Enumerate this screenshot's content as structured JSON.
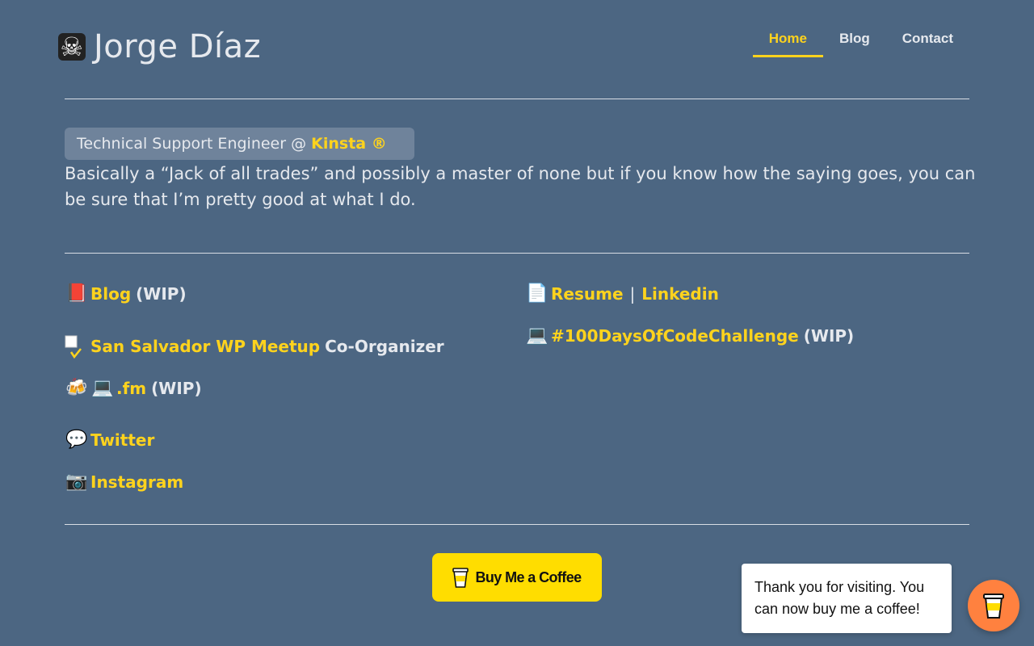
{
  "header": {
    "logo_emoji": "☠",
    "site_name": "Jorge Díaz",
    "nav": [
      {
        "label": "Home",
        "active": true
      },
      {
        "label": "Blog",
        "active": false
      },
      {
        "label": "Contact",
        "active": false
      }
    ]
  },
  "intro": {
    "role_prefix": "Technical Support Engineer @ ",
    "role_company": "Kinsta ®",
    "bio": "Basically a “Jack of all trades” and possibly a master of none but if you know how the saying goes, you can be sure that I’m pretty good at what I do."
  },
  "links": {
    "blog": {
      "icon": "📕",
      "label": "Blog",
      "note": "(WIP)"
    },
    "meetup": {
      "icon": "broken-image-icon",
      "label": "San Salvador WP Meetup",
      "note": "Co-Organizer"
    },
    "podcast": {
      "icon1": "🍻",
      "icon2": "💻",
      "label": ".fm",
      "note": "(WIP)"
    },
    "twitter": {
      "icon": "💬",
      "label": "Twitter"
    },
    "instagram": {
      "icon": "📷",
      "label": "Instagram"
    },
    "resume": {
      "icon": "📄",
      "label": "Resume",
      "separator": "|",
      "label2": "Linkedin"
    },
    "challenge": {
      "icon": "💻",
      "label": "#100DaysOfCodeChallenge",
      "note": "(WIP)"
    }
  },
  "coffee": {
    "button_label": "Buy Me a Coffee",
    "toast": "Thank you for visiting. You can now buy me a coffee!"
  },
  "colors": {
    "background": "#4c6682",
    "accent": "#ffd31d",
    "bmc_yellow": "#ffdd00",
    "bmc_orange": "#ff813f"
  }
}
